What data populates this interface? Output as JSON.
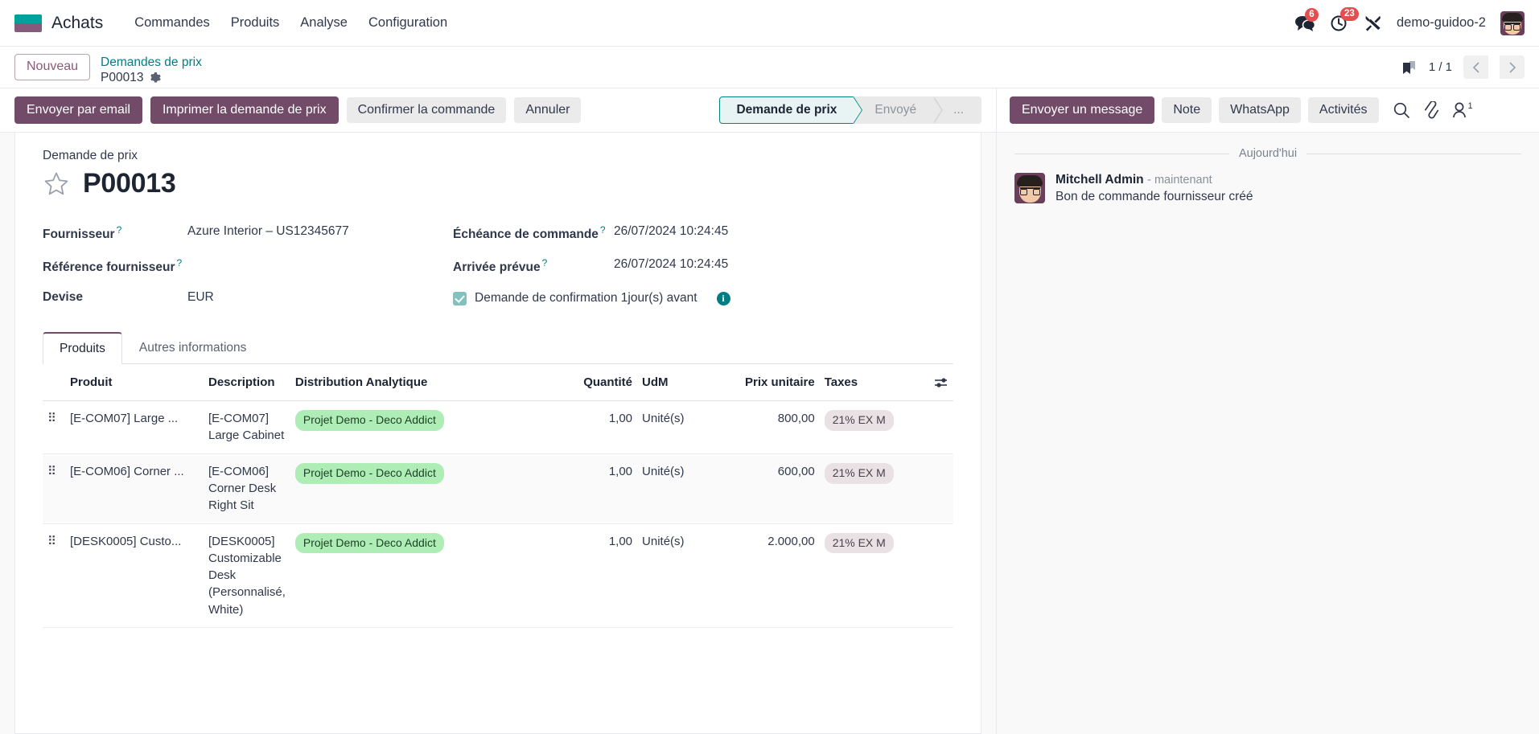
{
  "navbar": {
    "brand": "Achats",
    "menu": [
      "Commandes",
      "Produits",
      "Analyse",
      "Configuration"
    ],
    "messages_badge": "6",
    "activities_badge": "23",
    "user": "demo-guidoo-2"
  },
  "control_panel": {
    "new_button": "Nouveau",
    "breadcrumb_parent": "Demandes de prix",
    "breadcrumb_current": "P00013",
    "pager": "1 / 1"
  },
  "toolbar": {
    "buttons": [
      {
        "label": "Envoyer par email",
        "style": "primary"
      },
      {
        "label": "Imprimer la demande de prix",
        "style": "primary"
      },
      {
        "label": "Confirmer la commande",
        "style": "secondary"
      },
      {
        "label": "Annuler",
        "style": "secondary"
      }
    ],
    "statusbar": [
      {
        "label": "Demande de prix",
        "active": true
      },
      {
        "label": "Envoyé",
        "active": false
      },
      {
        "label": "...",
        "active": false
      }
    ]
  },
  "form": {
    "subtitle": "Demande de prix",
    "title": "P00013",
    "fields": {
      "fournisseur_label": "Fournisseur",
      "fournisseur_value": "Azure Interior – US12345677",
      "reference_label": "Référence fournisseur",
      "reference_value": "",
      "devise_label": "Devise",
      "devise_value": "EUR",
      "echeance_label": "Échéance de commande",
      "echeance_value": "26/07/2024 10:24:45",
      "arrivee_label": "Arrivée prévue",
      "arrivee_value": "26/07/2024 10:24:45",
      "confirmation_label": "Demande de confirmation 1jour(s) avant"
    }
  },
  "notebook": {
    "tabs": [
      {
        "label": "Produits",
        "active": true
      },
      {
        "label": "Autres informations",
        "active": false
      }
    ]
  },
  "lines_table": {
    "headers": {
      "produit": "Produit",
      "description": "Description",
      "analytique": "Distribution Analytique",
      "quantite": "Quantité",
      "udm": "UdM",
      "prix": "Prix unitaire",
      "taxes": "Taxes"
    },
    "rows": [
      {
        "produit": "[E-COM07] Large ...",
        "description": "[E-COM07] Large Cabinet",
        "analytique": "Projet Demo - Deco Addict",
        "quantite": "1,00",
        "udm": "Unité(s)",
        "prix": "800,00",
        "taxes": "21% EX M"
      },
      {
        "produit": "[E-COM06] Corner ...",
        "description": "[E-COM06] Corner Desk Right Sit",
        "analytique": "Projet Demo - Deco Addict",
        "quantite": "1,00",
        "udm": "Unité(s)",
        "prix": "600,00",
        "taxes": "21% EX M"
      },
      {
        "produit": "[DESK0005] Custo...",
        "description": "[DESK0005] Customizable Desk (Personnalisé, White)",
        "analytique": "Projet Demo - Deco Addict",
        "quantite": "1,00",
        "udm": "Unité(s)",
        "prix": "2.000,00",
        "taxes": "21% EX M"
      }
    ]
  },
  "chatter": {
    "send_message": "Envoyer un message",
    "note": "Note",
    "whatsapp": "WhatsApp",
    "activities": "Activités",
    "follower_count": "1",
    "date_separator": "Aujourd'hui",
    "message": {
      "author": "Mitchell Admin",
      "time": "- maintenant",
      "body": "Bon de commande fournisseur créé"
    }
  },
  "colors": {
    "primary": "#714b67",
    "teal": "#017e84",
    "tag_green": "#aeeeb6",
    "tag_grey": "#e9e1e4",
    "badge_red": "#e34f4f"
  }
}
